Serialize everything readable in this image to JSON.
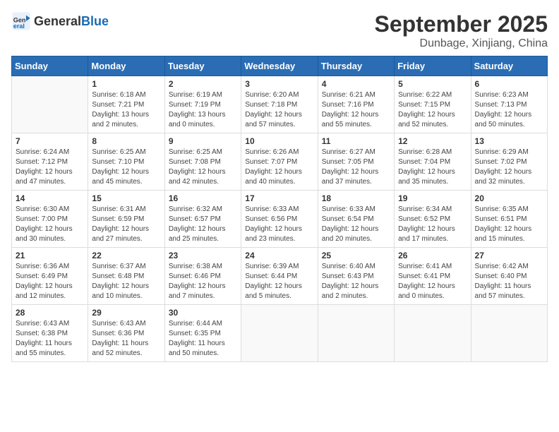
{
  "header": {
    "logo_general": "General",
    "logo_blue": "Blue",
    "month": "September 2025",
    "location": "Dunbage, Xinjiang, China"
  },
  "weekdays": [
    "Sunday",
    "Monday",
    "Tuesday",
    "Wednesday",
    "Thursday",
    "Friday",
    "Saturday"
  ],
  "weeks": [
    [
      {
        "day": "",
        "info": ""
      },
      {
        "day": "1",
        "info": "Sunrise: 6:18 AM\nSunset: 7:21 PM\nDaylight: 13 hours\nand 2 minutes."
      },
      {
        "day": "2",
        "info": "Sunrise: 6:19 AM\nSunset: 7:19 PM\nDaylight: 13 hours\nand 0 minutes."
      },
      {
        "day": "3",
        "info": "Sunrise: 6:20 AM\nSunset: 7:18 PM\nDaylight: 12 hours\nand 57 minutes."
      },
      {
        "day": "4",
        "info": "Sunrise: 6:21 AM\nSunset: 7:16 PM\nDaylight: 12 hours\nand 55 minutes."
      },
      {
        "day": "5",
        "info": "Sunrise: 6:22 AM\nSunset: 7:15 PM\nDaylight: 12 hours\nand 52 minutes."
      },
      {
        "day": "6",
        "info": "Sunrise: 6:23 AM\nSunset: 7:13 PM\nDaylight: 12 hours\nand 50 minutes."
      }
    ],
    [
      {
        "day": "7",
        "info": "Sunrise: 6:24 AM\nSunset: 7:12 PM\nDaylight: 12 hours\nand 47 minutes."
      },
      {
        "day": "8",
        "info": "Sunrise: 6:25 AM\nSunset: 7:10 PM\nDaylight: 12 hours\nand 45 minutes."
      },
      {
        "day": "9",
        "info": "Sunrise: 6:25 AM\nSunset: 7:08 PM\nDaylight: 12 hours\nand 42 minutes."
      },
      {
        "day": "10",
        "info": "Sunrise: 6:26 AM\nSunset: 7:07 PM\nDaylight: 12 hours\nand 40 minutes."
      },
      {
        "day": "11",
        "info": "Sunrise: 6:27 AM\nSunset: 7:05 PM\nDaylight: 12 hours\nand 37 minutes."
      },
      {
        "day": "12",
        "info": "Sunrise: 6:28 AM\nSunset: 7:04 PM\nDaylight: 12 hours\nand 35 minutes."
      },
      {
        "day": "13",
        "info": "Sunrise: 6:29 AM\nSunset: 7:02 PM\nDaylight: 12 hours\nand 32 minutes."
      }
    ],
    [
      {
        "day": "14",
        "info": "Sunrise: 6:30 AM\nSunset: 7:00 PM\nDaylight: 12 hours\nand 30 minutes."
      },
      {
        "day": "15",
        "info": "Sunrise: 6:31 AM\nSunset: 6:59 PM\nDaylight: 12 hours\nand 27 minutes."
      },
      {
        "day": "16",
        "info": "Sunrise: 6:32 AM\nSunset: 6:57 PM\nDaylight: 12 hours\nand 25 minutes."
      },
      {
        "day": "17",
        "info": "Sunrise: 6:33 AM\nSunset: 6:56 PM\nDaylight: 12 hours\nand 23 minutes."
      },
      {
        "day": "18",
        "info": "Sunrise: 6:33 AM\nSunset: 6:54 PM\nDaylight: 12 hours\nand 20 minutes."
      },
      {
        "day": "19",
        "info": "Sunrise: 6:34 AM\nSunset: 6:52 PM\nDaylight: 12 hours\nand 17 minutes."
      },
      {
        "day": "20",
        "info": "Sunrise: 6:35 AM\nSunset: 6:51 PM\nDaylight: 12 hours\nand 15 minutes."
      }
    ],
    [
      {
        "day": "21",
        "info": "Sunrise: 6:36 AM\nSunset: 6:49 PM\nDaylight: 12 hours\nand 12 minutes."
      },
      {
        "day": "22",
        "info": "Sunrise: 6:37 AM\nSunset: 6:48 PM\nDaylight: 12 hours\nand 10 minutes."
      },
      {
        "day": "23",
        "info": "Sunrise: 6:38 AM\nSunset: 6:46 PM\nDaylight: 12 hours\nand 7 minutes."
      },
      {
        "day": "24",
        "info": "Sunrise: 6:39 AM\nSunset: 6:44 PM\nDaylight: 12 hours\nand 5 minutes."
      },
      {
        "day": "25",
        "info": "Sunrise: 6:40 AM\nSunset: 6:43 PM\nDaylight: 12 hours\nand 2 minutes."
      },
      {
        "day": "26",
        "info": "Sunrise: 6:41 AM\nSunset: 6:41 PM\nDaylight: 12 hours\nand 0 minutes."
      },
      {
        "day": "27",
        "info": "Sunrise: 6:42 AM\nSunset: 6:40 PM\nDaylight: 11 hours\nand 57 minutes."
      }
    ],
    [
      {
        "day": "28",
        "info": "Sunrise: 6:43 AM\nSunset: 6:38 PM\nDaylight: 11 hours\nand 55 minutes."
      },
      {
        "day": "29",
        "info": "Sunrise: 6:43 AM\nSunset: 6:36 PM\nDaylight: 11 hours\nand 52 minutes."
      },
      {
        "day": "30",
        "info": "Sunrise: 6:44 AM\nSunset: 6:35 PM\nDaylight: 11 hours\nand 50 minutes."
      },
      {
        "day": "",
        "info": ""
      },
      {
        "day": "",
        "info": ""
      },
      {
        "day": "",
        "info": ""
      },
      {
        "day": "",
        "info": ""
      }
    ]
  ]
}
